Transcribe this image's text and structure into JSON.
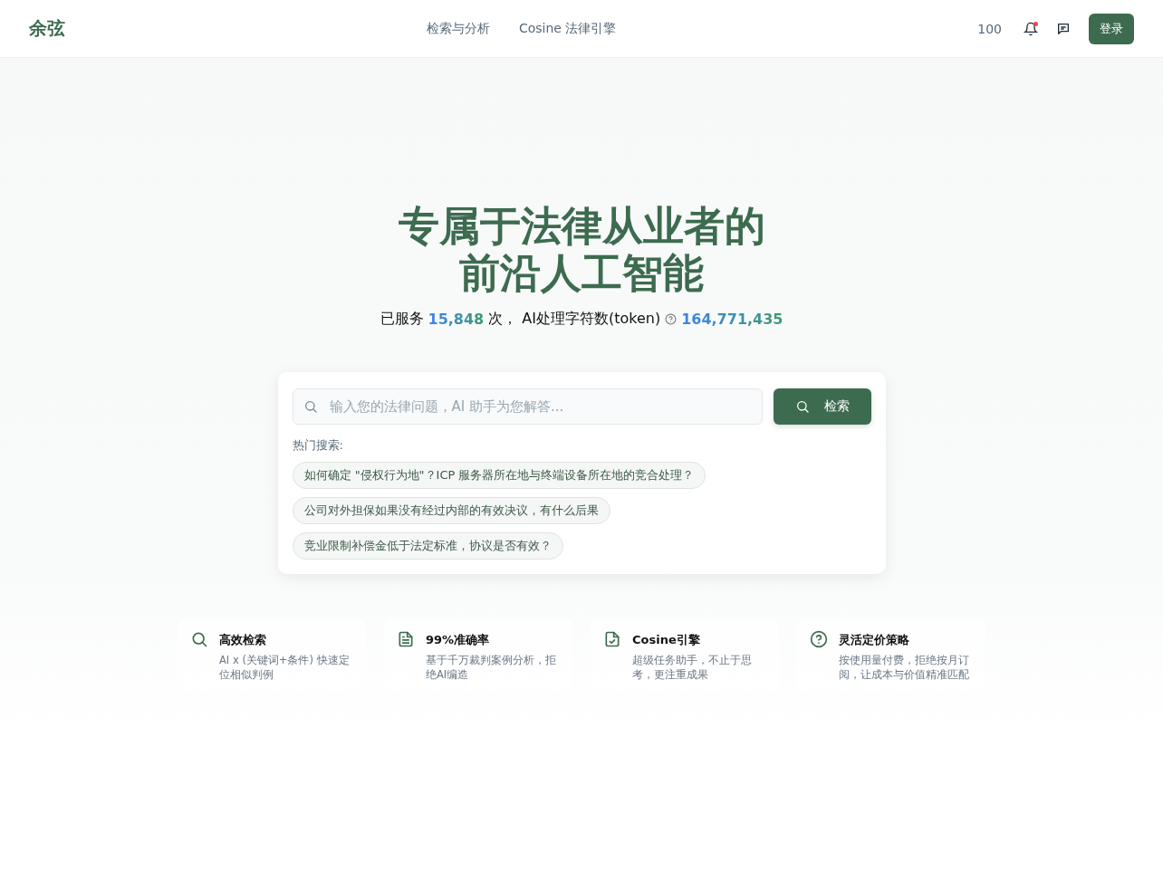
{
  "header": {
    "logo": "余弦",
    "nav": [
      {
        "label": "检索与分析"
      },
      {
        "label": "Cosine 法律引擎"
      }
    ],
    "credits": "100",
    "notification_dot": true,
    "login": "登录"
  },
  "hero": {
    "title_lines": [
      "专属于法律从业者的",
      "前沿人工智能"
    ],
    "stats": {
      "prefix": "已服务",
      "served": "15,848",
      "served_unit": "次，",
      "token_label": "AI处理字符数(token)",
      "tokens": "164,771,435"
    }
  },
  "search": {
    "placeholder": "输入您的法律问题，AI 助手为您解答...",
    "button": "检索",
    "hot_label": "热门搜索:",
    "hot": [
      "如何确定 \"侵权行为地\"？ICP 服务器所在地与终端设备所在地的竞合处理？",
      "公司对外担保如果没有经过内部的有效决议，有什么后果",
      "竞业限制补偿金低于法定标准，协议是否有效？"
    ]
  },
  "features": [
    {
      "kind": "search",
      "title": "高效检索",
      "text": "AI x (关键词+条件) 快速定位相似判例"
    },
    {
      "kind": "document",
      "title": "99%准确率",
      "text": "基于千万裁判案例分析，拒绝AI编造"
    },
    {
      "kind": "check",
      "title": "Cosine引擎",
      "text": "超级任务助手，不止于思考，更注重成果"
    },
    {
      "kind": "help",
      "title": "灵活定价策略",
      "text": "按使用量付费，拒绝按月订阅，让成本与价值精准匹配"
    }
  ]
}
